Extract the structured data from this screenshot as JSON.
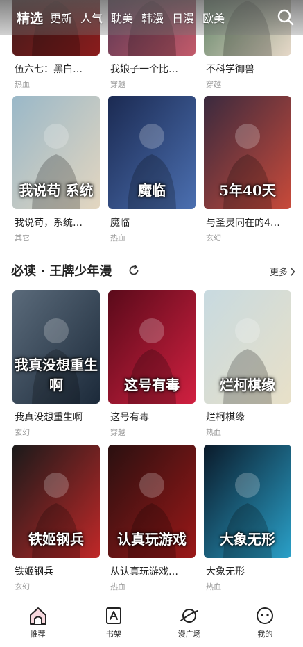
{
  "top_nav": {
    "tabs": [
      "精选",
      "更新",
      "人气",
      "耽美",
      "韩漫",
      "日漫",
      "欧美"
    ],
    "active_index": 0,
    "search_icon": "search-icon"
  },
  "rows": [
    {
      "items": [
        {
          "title": "伍六七：黑白…",
          "genre": "热血",
          "cover_text": "",
          "colors": [
            "#2b1a1a",
            "#8a1c1c"
          ]
        },
        {
          "title": "我娘子一个比…",
          "genre": "穿越",
          "cover_text": "",
          "colors": [
            "#3a2c4a",
            "#c25a6a"
          ]
        },
        {
          "title": "不科学御兽",
          "genre": "穿越",
          "cover_text": "",
          "colors": [
            "#3a6a4a",
            "#e6d8c8"
          ]
        }
      ]
    },
    {
      "items": [
        {
          "title": "我说苟，系统…",
          "genre": "其它",
          "cover_text": "我说苟 系统",
          "colors": [
            "#9ab8c8",
            "#e3d6c0"
          ]
        },
        {
          "title": "魔临",
          "genre": "热血",
          "cover_text": "魔临",
          "colors": [
            "#1b2a52",
            "#4b6fb0"
          ]
        },
        {
          "title": "与圣灵同在的4…",
          "genre": "玄幻",
          "cover_text": "5年40天",
          "colors": [
            "#3a2a3e",
            "#c84a3a"
          ]
        }
      ]
    },
    {
      "items": [
        {
          "title": "我真没想重生啊",
          "genre": "玄幻",
          "cover_text": "我真没想重生啊",
          "colors": [
            "#5a6a7a",
            "#1c2a3a"
          ]
        },
        {
          "title": "这号有毒",
          "genre": "穿越",
          "cover_text": "这号有毒",
          "colors": [
            "#5a0a1a",
            "#d02040"
          ]
        },
        {
          "title": "烂柯棋缘",
          "genre": "热血",
          "cover_text": "烂柯棋缘",
          "colors": [
            "#c8dae0",
            "#e8e0c8"
          ]
        }
      ]
    },
    {
      "items": [
        {
          "title": "铁姬钢兵",
          "genre": "玄幻",
          "cover_text": "铁姬钢兵",
          "colors": [
            "#1a1a1a",
            "#c02828"
          ]
        },
        {
          "title": "从认真玩游戏…",
          "genre": "热血",
          "cover_text": "认真玩游戏",
          "colors": [
            "#2a1010",
            "#9a1818"
          ]
        },
        {
          "title": "大象无形",
          "genre": "热血",
          "cover_text": "大象无形",
          "colors": [
            "#0a1a2a",
            "#2aa0c8"
          ]
        }
      ]
    }
  ],
  "section": {
    "title": "必读 · 王牌少年漫",
    "more_label": "更多",
    "refresh_icon": "refresh-icon"
  },
  "bottom_tabs": [
    {
      "label": "推荐",
      "icon": "home-icon",
      "active": true
    },
    {
      "label": "书架",
      "icon": "bookshelf-icon",
      "active": false
    },
    {
      "label": "漫广场",
      "icon": "planet-icon",
      "active": false
    },
    {
      "label": "我的",
      "icon": "profile-icon",
      "active": false
    }
  ]
}
